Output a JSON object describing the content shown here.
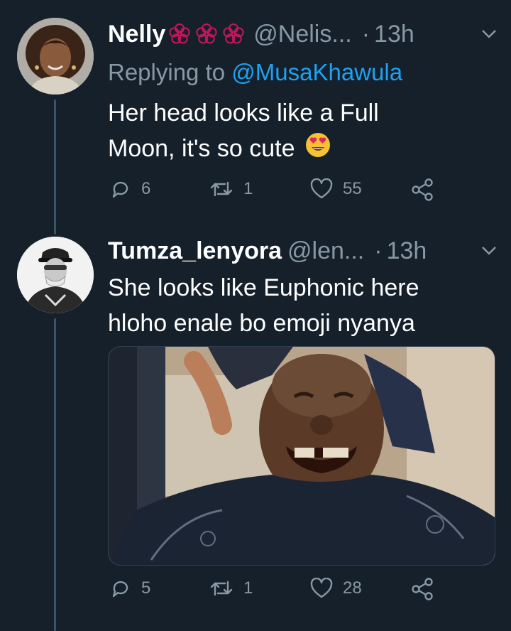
{
  "tweets": [
    {
      "name": "Nelly",
      "handle": "@Nelis...",
      "dot": "·",
      "time": "13h",
      "reply_label": "Replying to",
      "reply_mention": "@MusaKhawula",
      "text_line1": "Her head looks like a Full",
      "text_line2": "Moon, it's so cute",
      "emoji": "heart-eyes-emoji",
      "replies": "6",
      "retweets": "1",
      "likes": "55"
    },
    {
      "name": "Tumza_lenyora",
      "handle": "@len...",
      "dot": "·",
      "time": "13h",
      "text_line1": "She looks like Euphonic here",
      "text_line2": "hloho enale bo emoji nyanya",
      "replies": "5",
      "retweets": "1",
      "likes": "28"
    }
  ],
  "colors": {
    "background": "#15202b",
    "secondary_text": "#8899a6",
    "mention": "#1da1f2",
    "thread_line": "#3d5466"
  }
}
